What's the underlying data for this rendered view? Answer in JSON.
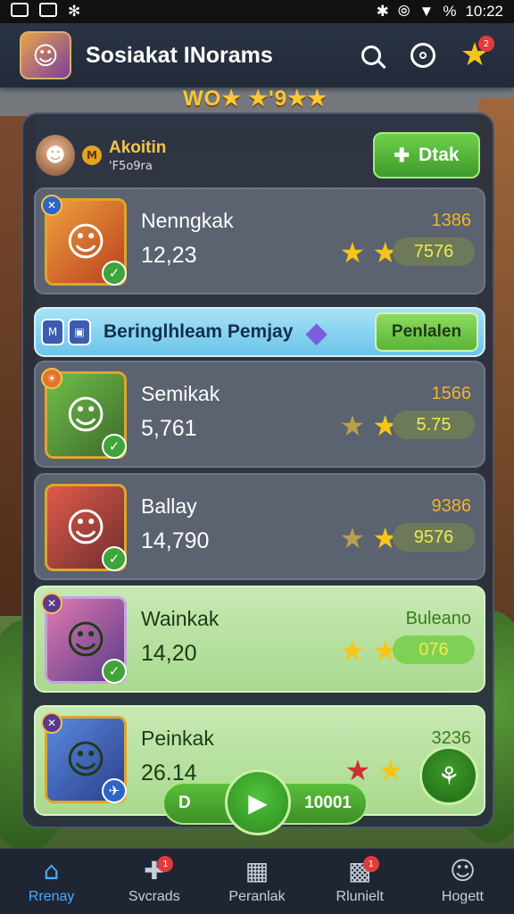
{
  "status_bar": {
    "time": "10:22",
    "battery": "%"
  },
  "header": {
    "title": "Sosiakat INorams",
    "notification_count": "2"
  },
  "banner": {
    "text": "WO★ ★'9★★"
  },
  "player": {
    "name": "Akoitin",
    "sub": "'F5o9ra",
    "coin_label": "M",
    "action_label": "Dtak"
  },
  "cards": [
    {
      "name": "Nenngkak",
      "value": "12,23",
      "top_right": "1386",
      "pill": "7576"
    },
    {
      "name": "Semikak",
      "value": "5,761",
      "top_right": "1566",
      "pill": "5.75"
    },
    {
      "name": "Ballay",
      "value": "14,790",
      "top_right": "9386",
      "pill": "9576"
    },
    {
      "name": "Wainkak",
      "value": "14,20",
      "top_right": "Buleano",
      "pill": "076"
    },
    {
      "name": "Peinkak",
      "value": "26.14",
      "top_right": "3236"
    }
  ],
  "event_banner": {
    "text": "Beringlhleam Pemjay",
    "button_label": "Penlalen"
  },
  "floating_bar": {
    "left": "D",
    "right": "10001"
  },
  "bottom_nav": [
    {
      "label": "Rrenay"
    },
    {
      "label": "Svcrads",
      "badge": "1"
    },
    {
      "label": "Peranlak"
    },
    {
      "label": "Rlunielt",
      "badge": "1"
    },
    {
      "label": "Hogett"
    }
  ],
  "colors": {
    "accent_green": "#5abf3a",
    "gold": "#f5c518",
    "nav_active": "#4aa9ff"
  }
}
